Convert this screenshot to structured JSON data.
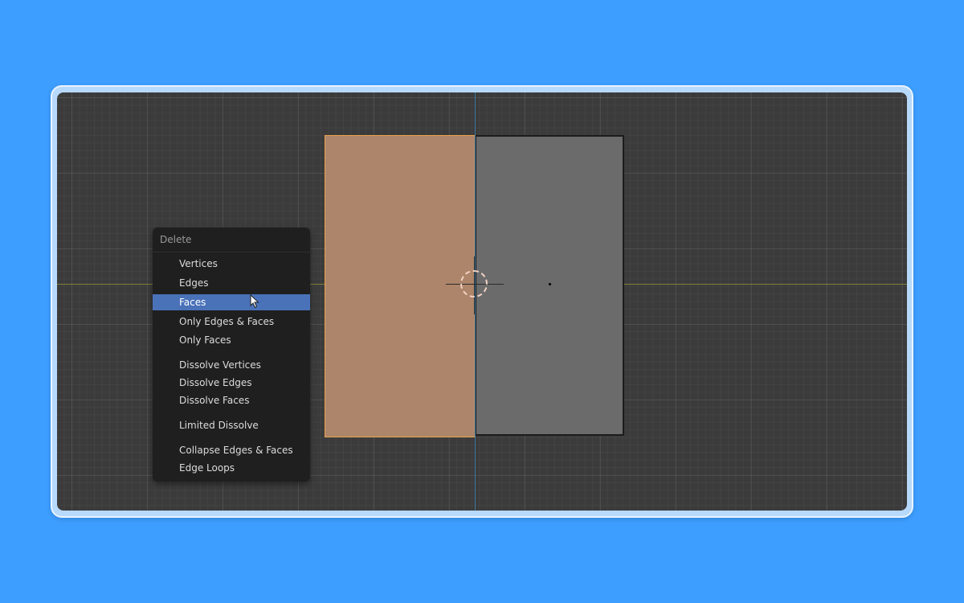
{
  "menu": {
    "title": "Delete",
    "items": [
      {
        "label": "Vertices",
        "selected": false
      },
      {
        "label": "Edges",
        "selected": false
      },
      {
        "label": "Faces",
        "selected": true
      },
      {
        "label": "Only Edges & Faces",
        "selected": false
      },
      {
        "label": "Only Faces",
        "selected": false
      },
      {
        "label": "Dissolve Vertices",
        "selected": false
      },
      {
        "label": "Dissolve Edges",
        "selected": false
      },
      {
        "label": "Dissolve Faces",
        "selected": false
      },
      {
        "label": "Limited Dissolve",
        "selected": false
      },
      {
        "label": "Collapse Edges & Faces",
        "selected": false
      },
      {
        "label": "Edge Loops",
        "selected": false
      }
    ]
  },
  "viewport": {
    "background_color": "#3b3b3b",
    "selected_face_color": "#ad856a",
    "unselected_face_color": "#6b6b6b",
    "x_axis_color": "#8b8a3a",
    "y_axis_color": "#3e7fa8"
  },
  "icons": {
    "cursor": "3d-cursor-icon",
    "pointer": "mouse-pointer-icon"
  }
}
